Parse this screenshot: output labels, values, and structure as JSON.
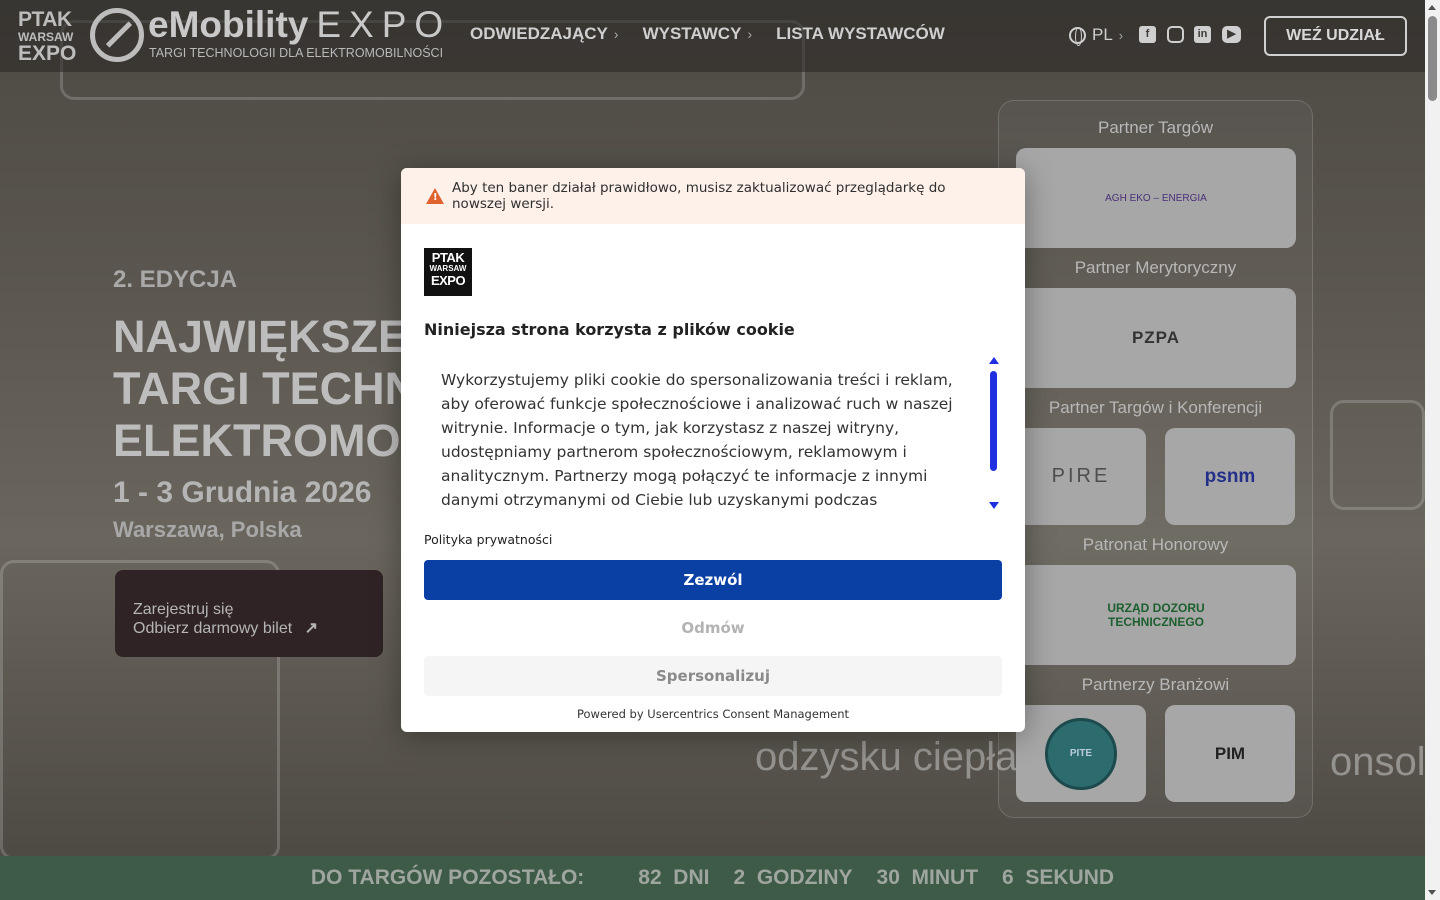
{
  "header": {
    "logo_ptak": [
      "PTAK",
      "WARSAW",
      "EXPO"
    ],
    "brand_name": "eMobility",
    "brand_expo": "EXPO",
    "brand_tagline": "TARGI TECHNOLOGII DLA ELEKTROMOBILNOŚCI",
    "nav": [
      {
        "label": "ODWIEDZAJĄCY",
        "chevron": "›"
      },
      {
        "label": "WYSTAWCY",
        "chevron": "›"
      },
      {
        "label": "LISTA WYSTAWCÓW",
        "chevron": ""
      }
    ],
    "language": "PL",
    "language_chevron": "›",
    "social": [
      "facebook-icon",
      "instagram-icon",
      "linkedin-icon",
      "youtube-icon"
    ],
    "cta": "WEŹ UDZIAŁ"
  },
  "hero": {
    "edition": "2. EDYCJA",
    "title_lines": [
      "NAJWIĘKSZE",
      "TARGI TECHN",
      "ELEKTROMO"
    ],
    "dates": "1 - 3 Grudnia 2026",
    "location": "Warszawa, Polska",
    "register_line1": "Zarejestruj się",
    "register_line2": "Odbierz darmowy bilet",
    "register_icon": "arrow-up-right-icon"
  },
  "background_text": {
    "sign_1": "odzysku ciepła",
    "sign_2": "onsola"
  },
  "partners": {
    "sections": [
      {
        "title": "Partner Targów",
        "logos": [
          "AGH EKO – ENERGIA"
        ]
      },
      {
        "title": "Partner Merytoryczny",
        "logos": [
          "PZPA"
        ]
      },
      {
        "title": "Partner Targów i Konferencji",
        "logos": [
          "PIRE",
          "psnm"
        ]
      },
      {
        "title": "Patronat Honorowy",
        "logos": [
          "URZĄD DOZORU TECHNICZNEGO"
        ]
      },
      {
        "title": "Partnerzy Branżowi",
        "logos": [
          "PITE",
          "PIM"
        ]
      }
    ]
  },
  "countdown": {
    "label": "DO TARGÓW POZOSTAŁO:",
    "items": [
      "82  DNI",
      "2  GODZINY",
      "30  MINUT",
      "6  SEKUND"
    ]
  },
  "cookie_modal": {
    "warning": "Aby ten baner działał prawidłowo, musisz zaktualizować przeglądarkę do nowszej wersji.",
    "logo": [
      "PTAK",
      "WARSAW",
      "EXPO"
    ],
    "title": "Niniejsza strona korzysta z plików cookie",
    "body": "Wykorzystujemy pliki cookie do spersonalizowania treści i reklam, aby oferować funkcje społecznościowe i analizować ruch w naszej witrynie. Informacje o tym, jak korzystasz z naszej witryny, udostępniamy partnerom społecznościowym, reklamowym i analitycznym. Partnerzy mogą połączyć te informacje z innymi danymi otrzymanymi od Ciebie lub uzyskanymi podczas",
    "privacy_link": "Polityka prywatności",
    "allow": "Zezwól",
    "deny": "Odmów",
    "customize": "Spersonalizuj",
    "powered_by": "Powered by Usercentrics Consent Management"
  },
  "colors": {
    "accent_button": "#0a3fa3",
    "warning_bg": "#fdf1ea",
    "countdown_bg": "#3e5b48"
  }
}
